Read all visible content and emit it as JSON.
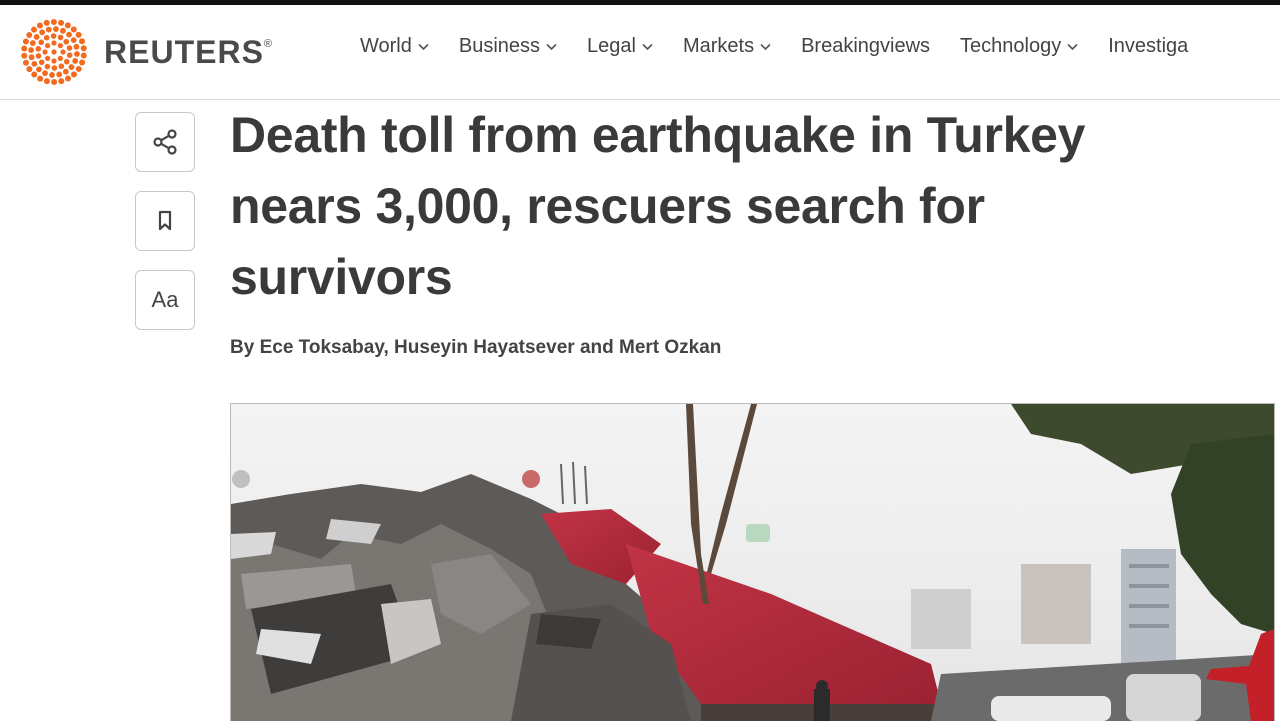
{
  "brand": {
    "name": "REUTERS",
    "mark": "®"
  },
  "nav": {
    "items": [
      {
        "label": "World",
        "has_dropdown": true
      },
      {
        "label": "Business",
        "has_dropdown": true
      },
      {
        "label": "Legal",
        "has_dropdown": true
      },
      {
        "label": "Markets",
        "has_dropdown": true
      },
      {
        "label": "Breakingviews",
        "has_dropdown": false
      },
      {
        "label": "Technology",
        "has_dropdown": true
      },
      {
        "label": "Investiga",
        "has_dropdown": false
      }
    ]
  },
  "article_tools": {
    "share_icon": "share-icon",
    "bookmark_icon": "bookmark-icon",
    "text_size_label": "Aa"
  },
  "article": {
    "headline": "Death toll from earthquake in Turkey nears 3,000, rescuers search for survivors",
    "byline": {
      "prefix": "By",
      "authors": "Ece Toksabay, Huseyin Hayatsever",
      "conjunction": "and",
      "last_author": "Mert Ozkan"
    }
  },
  "colors": {
    "brand_orange": "#f26b21",
    "text": "#3a3a3a",
    "roof_red": "#b82a3a"
  }
}
